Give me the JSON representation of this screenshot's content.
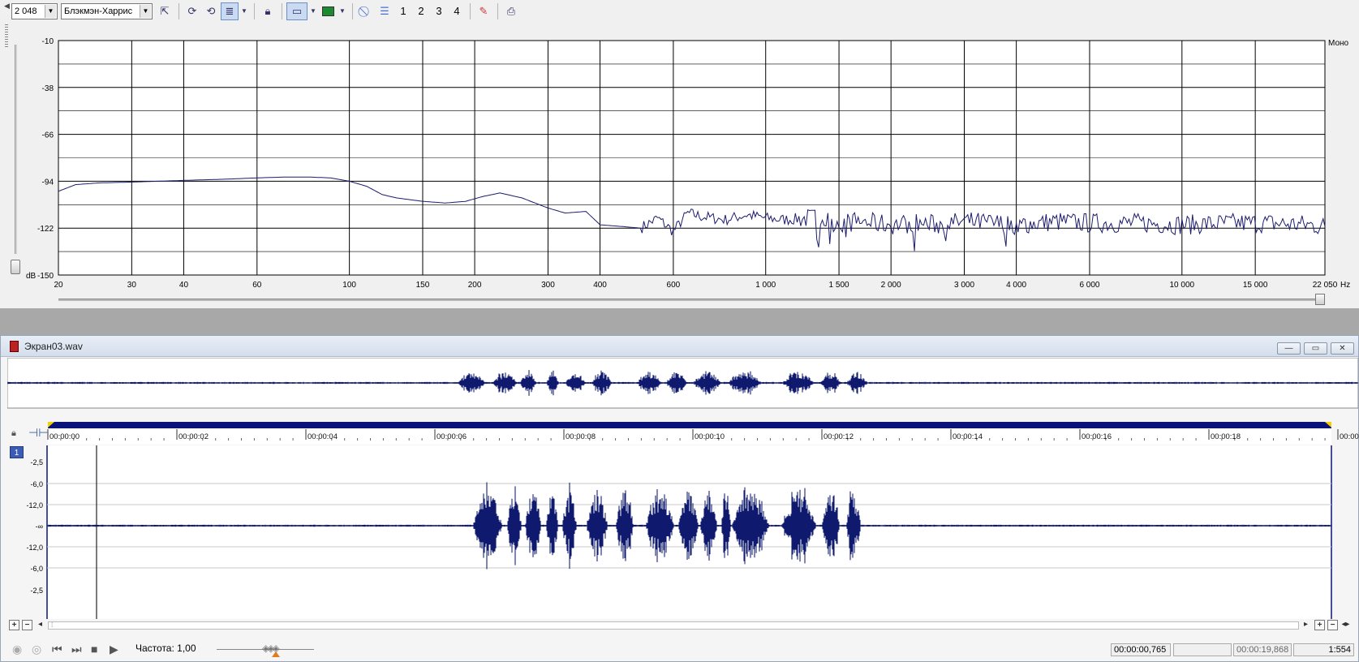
{
  "toolbar": {
    "fft_size": "2 048",
    "window_function": "Блэкмэн-Харрис",
    "numbers": [
      "1",
      "2",
      "3",
      "4"
    ],
    "icons": [
      "pointer-icon",
      "refresh-icon",
      "refresh-alt-icon",
      "snapshot-icon",
      "lock-icon",
      "view-mode-icon",
      "color-map-icon",
      "no-icon",
      "list-icon",
      "eraser-icon",
      "print-icon"
    ]
  },
  "spectrum": {
    "channel_label": "Моно",
    "db_unit": "dB",
    "hz_unit": "Hz"
  },
  "chart_data": {
    "type": "line",
    "title": "",
    "xlabel": "Hz",
    "ylabel": "dB",
    "x_scale": "log",
    "xlim": [
      20,
      22050
    ],
    "ylim": [
      -150,
      -10
    ],
    "grid": true,
    "x_ticks": [
      20,
      30,
      40,
      60,
      100,
      150,
      200,
      300,
      400,
      600,
      1000,
      1500,
      2000,
      3000,
      4000,
      6000,
      10000,
      15000,
      22050
    ],
    "x_tick_labels": [
      "20",
      "30",
      "40",
      "60",
      "100",
      "150",
      "200",
      "300",
      "400",
      "600",
      "1 000",
      "1 500",
      "2 000",
      "3 000",
      "4 000",
      "6 000",
      "10 000",
      "15 000",
      "22 050"
    ],
    "y_ticks": [
      -10,
      -38,
      -66,
      -94,
      -122,
      -150
    ],
    "y_tick_labels": [
      "-10",
      "-38",
      "-66",
      "-94",
      "-122",
      "-150"
    ],
    "series": [
      {
        "color": "#1c1c6e",
        "x": [
          20,
          22,
          25,
          30,
          40,
          50,
          60,
          70,
          80,
          90,
          100,
          110,
          120,
          130,
          150,
          170,
          190,
          210,
          230,
          260,
          300,
          330,
          370,
          400,
          450,
          500,
          550,
          600,
          650,
          700,
          800,
          900,
          1000,
          1100,
          1300,
          1500,
          1700,
          2000,
          2300,
          2600,
          3000,
          3500,
          4000,
          5000,
          6000,
          8000,
          10000,
          13000,
          16000,
          20000,
          22050
        ],
        "y": [
          -100,
          -96,
          -95,
          -94.5,
          -93.5,
          -92.8,
          -92,
          -91.5,
          -91.5,
          -92,
          -94,
          -97,
          -102,
          -104,
          -106,
          -107,
          -106,
          -103,
          -101,
          -104,
          -110,
          -113,
          -112,
          -120,
          -121,
          -122,
          -116,
          -124,
          -113,
          -115,
          -117,
          -114,
          -116,
          -117,
          -116,
          -119,
          -118,
          -120,
          -119,
          -120,
          -118,
          -119,
          -120,
          -118,
          -119,
          -119,
          -120,
          -119,
          -119,
          -120,
          -121
        ]
      }
    ]
  },
  "wave": {
    "filename": "Экран03.wav",
    "window_buttons": [
      "—",
      "▭",
      "✕"
    ],
    "time_labels": [
      "00:00:00",
      "00:00:02",
      "00:00:04",
      "00:00:06",
      "00:00:08",
      "00:00:10",
      "00:00:12",
      "00:00:14",
      "00:00:16",
      "00:00:18",
      "00:00:"
    ],
    "track_number": "1",
    "db_labels": [
      "-2,5",
      "-6,0",
      "-12,0",
      "-∞",
      "-12,0",
      "-6,0",
      "-2,5"
    ]
  },
  "scrollbar": {
    "plus": "+",
    "minus": "−",
    "left_arrow": "◂",
    "right_arrow": "▸"
  },
  "transport": {
    "rate_label": "Частота: 1,00",
    "cursor_time": "00:00:00,765",
    "selection": "",
    "total_time": "00:00:19,868",
    "zoom": "1:554"
  }
}
